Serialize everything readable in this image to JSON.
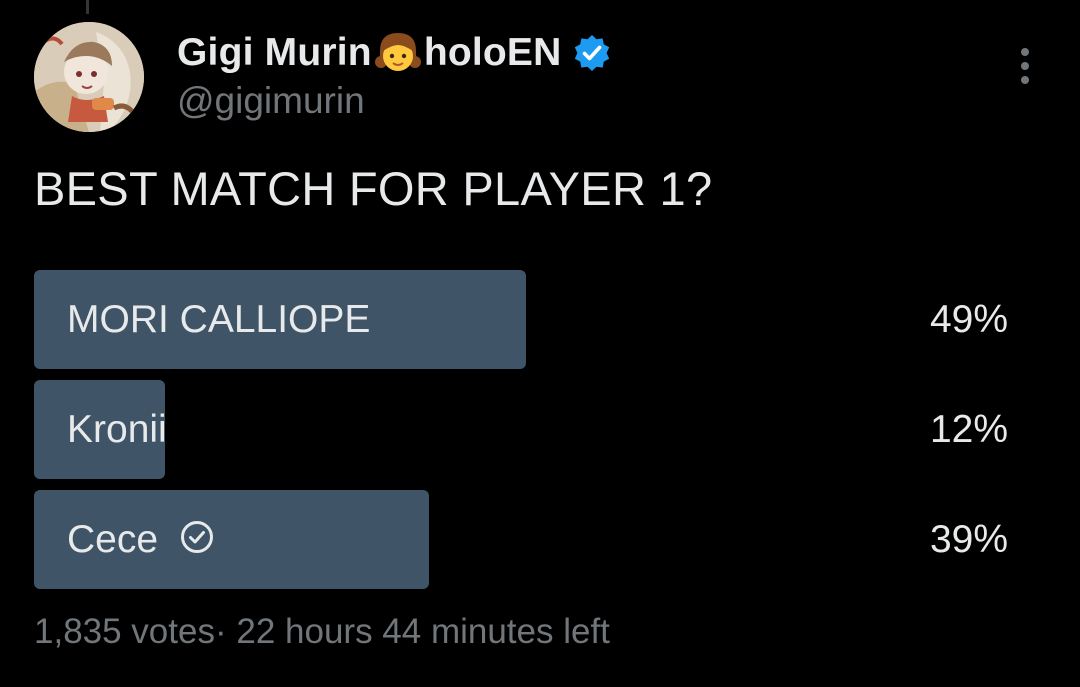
{
  "tweet": {
    "author": {
      "name_part1": "Gigi Murin",
      "name_emoji": "girl-emoji",
      "name_part2": "holoEN",
      "handle": "@gigimurin",
      "verified_color": "#1d9bf0"
    },
    "text": "BEST MATCH FOR PLAYER 1?"
  },
  "poll": {
    "options": [
      {
        "label": "MORI CALLIOPE",
        "percent_text": "49%",
        "fraction": 0.49,
        "voted": false
      },
      {
        "label": "Kronii",
        "percent_text": "12%",
        "fraction": 0.12,
        "voted": false
      },
      {
        "label": "Cece",
        "percent_text": "39%",
        "fraction": 0.39,
        "voted": true
      }
    ],
    "votes": "1,835 votes",
    "separator": "·",
    "time_left": "22 hours 44 minutes left",
    "bar_color": "#3f5567"
  },
  "icons": {
    "more": "more-dots-icon",
    "verified": "verified-badge-icon",
    "voted_check": "check-circle-icon"
  }
}
